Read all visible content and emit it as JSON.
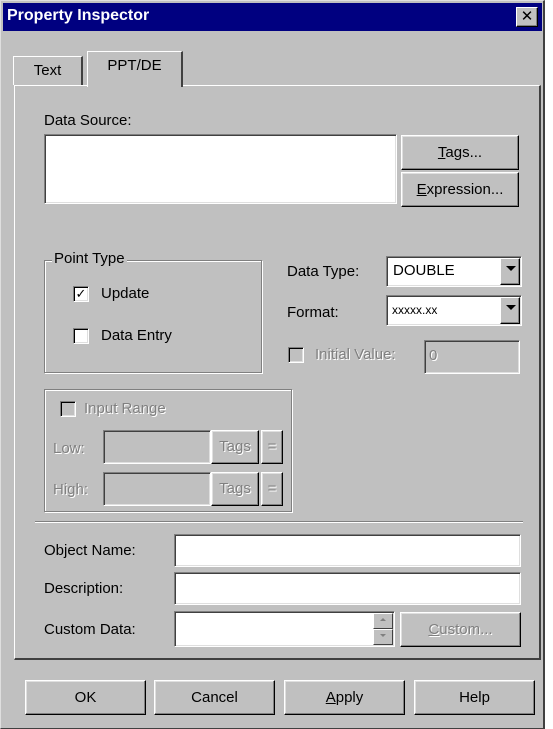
{
  "window": {
    "title": "Property Inspector",
    "close_label": "✕"
  },
  "tabs": [
    {
      "label": "Text",
      "selected": false
    },
    {
      "label": "PPT/DE",
      "selected": true
    }
  ],
  "data_source": {
    "label": "Data Source:",
    "value": "",
    "tags_button": {
      "before": "",
      "accel": "T",
      "after": "ags..."
    },
    "expression_button": {
      "before": "",
      "accel": "E",
      "after": "xpression..."
    }
  },
  "point_type": {
    "legend": "Point Type",
    "update": {
      "label": "Update",
      "checked": true
    },
    "data_entry": {
      "label": "Data Entry",
      "checked": false
    }
  },
  "data_type": {
    "label": "Data Type:",
    "value": "DOUBLE"
  },
  "format": {
    "label": "Format:",
    "value": "xxxxx.xx"
  },
  "initial_value": {
    "label": "Initial Value:",
    "value": "0",
    "checked": false,
    "enabled": false
  },
  "input_range": {
    "label": "Input Range",
    "checked": false,
    "enabled": false,
    "low_label": "Low:",
    "high_label": "High:",
    "low_value": "",
    "high_value": "",
    "tags_label": "Tags",
    "equals_label": "="
  },
  "object_name": {
    "label": "Object Name:",
    "value": ""
  },
  "description": {
    "label": "Description:",
    "value": ""
  },
  "custom_data": {
    "label": "Custom Data:",
    "value": "",
    "custom_button": {
      "before": "",
      "accel": "C",
      "after": "ustom..."
    }
  },
  "footer": {
    "ok": "OK",
    "cancel": "Cancel",
    "apply": {
      "before": "",
      "accel": "A",
      "after": "pply"
    },
    "help": "Help"
  },
  "colors": {
    "title_bar": "#000080",
    "face": "#c0c0c0",
    "disabled_text": "#808080"
  }
}
